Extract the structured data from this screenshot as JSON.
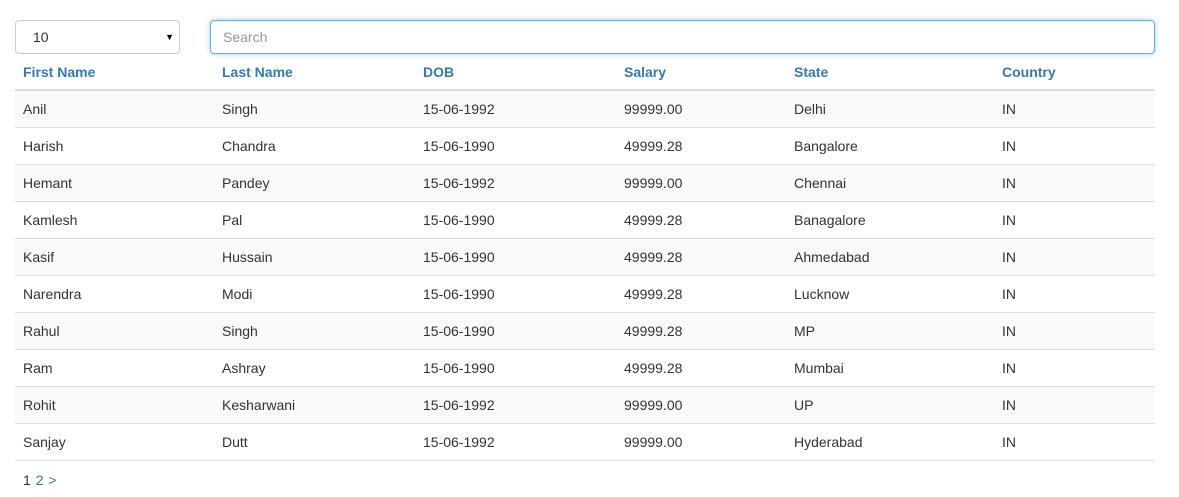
{
  "controls": {
    "page_size": "10",
    "search_placeholder": "Search",
    "search_value": ""
  },
  "table": {
    "headers": [
      "First Name",
      "Last Name",
      "DOB",
      "Salary",
      "State",
      "Country"
    ],
    "rows": [
      [
        "Anil",
        "Singh",
        "15-06-1992",
        "99999.00",
        "Delhi",
        "IN"
      ],
      [
        "Harish",
        "Chandra",
        "15-06-1990",
        "49999.28",
        "Bangalore",
        "IN"
      ],
      [
        "Hemant",
        "Pandey",
        "15-06-1992",
        "99999.00",
        "Chennai",
        "IN"
      ],
      [
        "Kamlesh",
        "Pal",
        "15-06-1990",
        "49999.28",
        "Banagalore",
        "IN"
      ],
      [
        "Kasif",
        "Hussain",
        "15-06-1990",
        "49999.28",
        "Ahmedabad",
        "IN"
      ],
      [
        "Narendra",
        "Modi",
        "15-06-1990",
        "49999.28",
        "Lucknow",
        "IN"
      ],
      [
        "Rahul",
        "Singh",
        "15-06-1990",
        "49999.28",
        "MP",
        "IN"
      ],
      [
        "Ram",
        "Ashray",
        "15-06-1990",
        "49999.28",
        "Mumbai",
        "IN"
      ],
      [
        "Rohit",
        "Kesharwani",
        "15-06-1992",
        "99999.00",
        "UP",
        "IN"
      ],
      [
        "Sanjay",
        "Dutt",
        "15-06-1992",
        "99999.00",
        "Hyderabad",
        "IN"
      ]
    ]
  },
  "pagination": {
    "current": "1",
    "next_page": "2",
    "next_arrow": ">"
  },
  "colors": {
    "link": "#337ab7",
    "focus_border": "#66afe9",
    "stripe": "#f9f9f9",
    "border": "#dddddd"
  }
}
